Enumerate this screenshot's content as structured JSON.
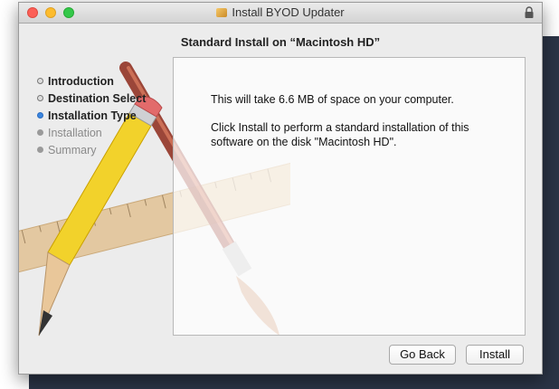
{
  "window": {
    "title": "Install BYOD Updater",
    "subtitle": "Standard Install on “Macintosh HD”"
  },
  "sidebar": {
    "steps": [
      {
        "label": "Introduction",
        "state": "done"
      },
      {
        "label": "Destination Select",
        "state": "done"
      },
      {
        "label": "Installation Type",
        "state": "current"
      },
      {
        "label": "Installation",
        "state": "pending"
      },
      {
        "label": "Summary",
        "state": "pending"
      }
    ]
  },
  "content": {
    "size_text": "This will take 6.6 MB of space on your computer.",
    "instruction_text": "Click Install to perform a standard installation of this software on the disk \"Macintosh HD\"."
  },
  "buttons": {
    "back": "Go Back",
    "install": "Install"
  },
  "colors": {
    "current_step": "#3b86e0",
    "close": "#fc5f57",
    "minimize": "#fdbc2e",
    "zoom": "#34c84a"
  },
  "icons": [
    "package-icon",
    "lock-icon",
    "installer-artwork"
  ]
}
